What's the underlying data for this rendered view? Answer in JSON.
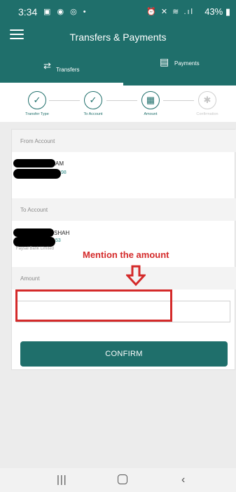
{
  "status_bar": {
    "time": "3:34",
    "left_icons": "▣ ◉ ◎ •",
    "right_icons": "⏰ ✕ ≋ .ıl",
    "battery": "43%"
  },
  "app_bar": {
    "title": "Transfers & Payments",
    "menu_icon": "hamburger-icon"
  },
  "tabs": [
    {
      "label": "Transfers",
      "icon": "transfer-icon",
      "active": true
    },
    {
      "label": "Payments",
      "icon": "receipt-icon",
      "active": false
    }
  ],
  "stepper": [
    {
      "label": "Transfer Type",
      "icon": "check-icon",
      "state": "done"
    },
    {
      "label": "To Account",
      "icon": "check-icon",
      "state": "done"
    },
    {
      "label": "Amount",
      "icon": "calculator-icon",
      "state": "current"
    },
    {
      "label": "Confirmation",
      "icon": "handshake-icon",
      "state": "pending"
    }
  ],
  "form": {
    "from_account": {
      "header": "From Account",
      "name_visible": "AM",
      "number_visible": "98"
    },
    "to_account": {
      "header": "To Account",
      "name_visible": "SHAH",
      "number_visible": "53",
      "bank": "Faysal Bank Limited"
    },
    "amount": {
      "header": "Amount",
      "value": ""
    },
    "confirm_label": "CONFIRM"
  },
  "annotation": {
    "text": "Mention the amount",
    "color": "#d42a2a"
  },
  "colors": {
    "primary": "#1f6f6b",
    "annotation": "#d42a2a"
  }
}
